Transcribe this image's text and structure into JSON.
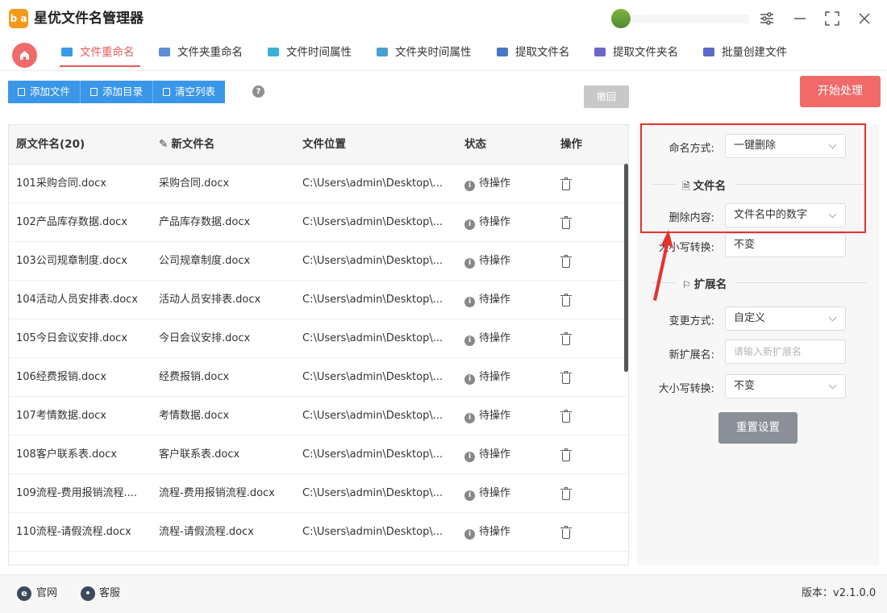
{
  "app": {
    "title": "星优文件名管理器",
    "logo_text": "b a"
  },
  "window": {
    "settings_icon": "sliders-icon",
    "minimize": "—",
    "maximize": "⛶",
    "close": "✕"
  },
  "nav": {
    "tabs": [
      {
        "label": "文件重命名",
        "icon_color": "#3a9ae8"
      },
      {
        "label": "文件夹重命名",
        "icon_color": "#5a8fd8"
      },
      {
        "label": "文件时间属性",
        "icon_color": "#3ab0d8"
      },
      {
        "label": "文件夹时间属性",
        "icon_color": "#4aa0d0"
      },
      {
        "label": "提取文件名",
        "icon_color": "#4a78c8"
      },
      {
        "label": "提取文件夹名",
        "icon_color": "#6a68c8"
      },
      {
        "label": "批量创建文件",
        "icon_color": "#5a6ac8"
      }
    ]
  },
  "toolbar": {
    "add_file": "添加文件",
    "add_dir": "添加目录",
    "clear_list": "清空列表",
    "help": "?",
    "undo": "撤回",
    "start": "开始处理"
  },
  "table": {
    "headers": {
      "original": "原文件名(20)",
      "new": "新文件名",
      "location": "文件位置",
      "status": "状态",
      "action": "操作"
    },
    "rows": [
      {
        "original": "101采购合同.docx",
        "new": "采购合同.docx",
        "location": "C:\\Users\\admin\\Desktop\\...",
        "status": "待操作"
      },
      {
        "original": "102产品库存数据.docx",
        "new": "产品库存数据.docx",
        "location": "C:\\Users\\admin\\Desktop\\...",
        "status": "待操作"
      },
      {
        "original": "103公司规章制度.docx",
        "new": "公司规章制度.docx",
        "location": "C:\\Users\\admin\\Desktop\\...",
        "status": "待操作"
      },
      {
        "original": "104活动人员安排表.docx",
        "new": "活动人员安排表.docx",
        "location": "C:\\Users\\admin\\Desktop\\...",
        "status": "待操作"
      },
      {
        "original": "105今日会议安排.docx",
        "new": "今日会议安排.docx",
        "location": "C:\\Users\\admin\\Desktop\\...",
        "status": "待操作"
      },
      {
        "original": "106经费报销.docx",
        "new": "经费报销.docx",
        "location": "C:\\Users\\admin\\Desktop\\...",
        "status": "待操作"
      },
      {
        "original": "107考情数据.docx",
        "new": "考情数据.docx",
        "location": "C:\\Users\\admin\\Desktop\\...",
        "status": "待操作"
      },
      {
        "original": "108客户联系表.docx",
        "new": "客户联系表.docx",
        "location": "C:\\Users\\admin\\Desktop\\...",
        "status": "待操作"
      },
      {
        "original": "109流程-费用报销流程....",
        "new": "流程-费用报销流程.docx",
        "location": "C:\\Users\\admin\\Desktop\\...",
        "status": "待操作"
      },
      {
        "original": "110流程-请假流程.docx",
        "new": "流程-请假流程.docx",
        "location": "C:\\Users\\admin\\Desktop\\...",
        "status": "待操作"
      },
      {
        "original": "",
        "new": "",
        "location": "",
        "status": ""
      }
    ]
  },
  "panel": {
    "naming_mode_label": "命名方式:",
    "naming_mode_value": "一键删除",
    "filename_section": "文件名",
    "delete_content_label": "删除内容:",
    "delete_content_value": "文件名中的数字",
    "case_label": "大小写转换:",
    "case_value": "不变",
    "ext_section": "扩展名",
    "change_mode_label": "变更方式:",
    "change_mode_value": "自定义",
    "new_ext_label": "新扩展名:",
    "new_ext_placeholder": "请输入新扩展名",
    "ext_case_label": "大小写转换:",
    "ext_case_value": "不变",
    "reset": "重置设置",
    "highlight_color": "#e5322d"
  },
  "footer": {
    "website": "官网",
    "support": "客服",
    "version": "版本：v2.1.0.0"
  }
}
